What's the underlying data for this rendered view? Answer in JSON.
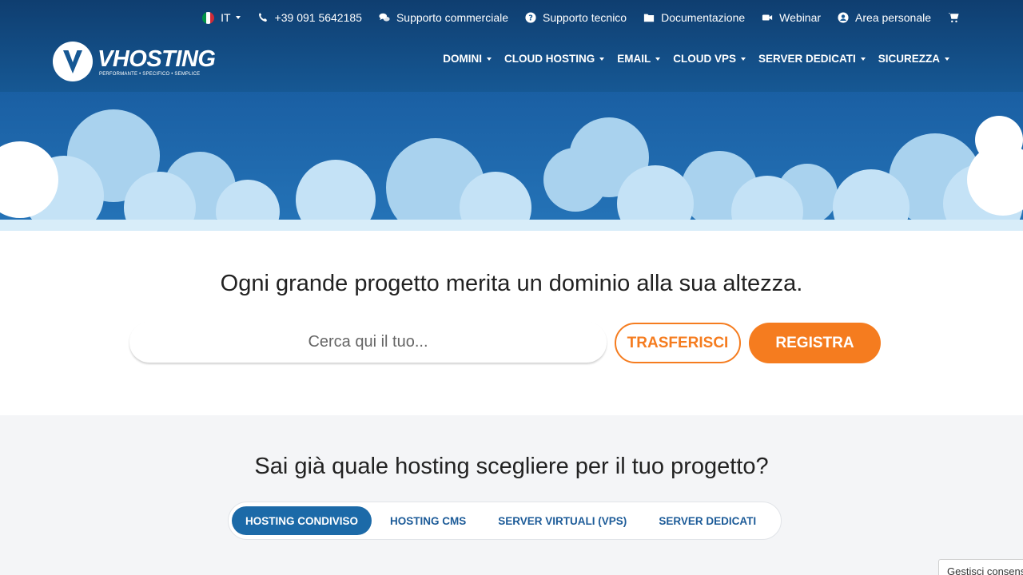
{
  "colors": {
    "header_top": "#0f3e70",
    "header_bottom": "#165894",
    "accent_orange": "#f57c1f",
    "tab_active": "#1c6aa8",
    "section_gray": "#f4f5f7"
  },
  "topbar": {
    "language": "IT",
    "phone": "+39 091 5642185",
    "sales_support": "Supporto commerciale",
    "tech_support": "Supporto tecnico",
    "docs": "Documentazione",
    "webinar": "Webinar",
    "account": "Area personale",
    "icons": [
      "italy-flag-icon",
      "phone-icon",
      "chat-icon",
      "question-circle-icon",
      "folder-icon",
      "video-camera-icon",
      "user-circle-icon",
      "cart-icon"
    ]
  },
  "logo": {
    "name": "VHOSTING",
    "tagline": "PERFORMANTE • SPECIFICO • SEMPLICE"
  },
  "nav": {
    "items": [
      {
        "label": "DOMINI"
      },
      {
        "label": "CLOUD HOSTING"
      },
      {
        "label": "EMAIL"
      },
      {
        "label": "CLOUD VPS"
      },
      {
        "label": "SERVER DEDICATI"
      },
      {
        "label": "SICUREZZA"
      }
    ]
  },
  "domain_search": {
    "headline": "Ogni grande progetto merita un dominio alla sua altezza.",
    "placeholder": "Cerca qui il tuo...",
    "transfer_label": "TRASFERISCI",
    "register_label": "REGISTRA"
  },
  "hosting": {
    "question": "Sai già quale hosting scegliere per il tuo progetto?",
    "tabs": [
      {
        "label": "HOSTING CONDIVISO",
        "active": true
      },
      {
        "label": "HOSTING CMS",
        "active": false
      },
      {
        "label": "SERVER VIRTUALI (VPS)",
        "active": false
      },
      {
        "label": "SERVER DEDICATI",
        "active": false
      }
    ]
  },
  "consent": {
    "label": "Gestisci consenso"
  }
}
